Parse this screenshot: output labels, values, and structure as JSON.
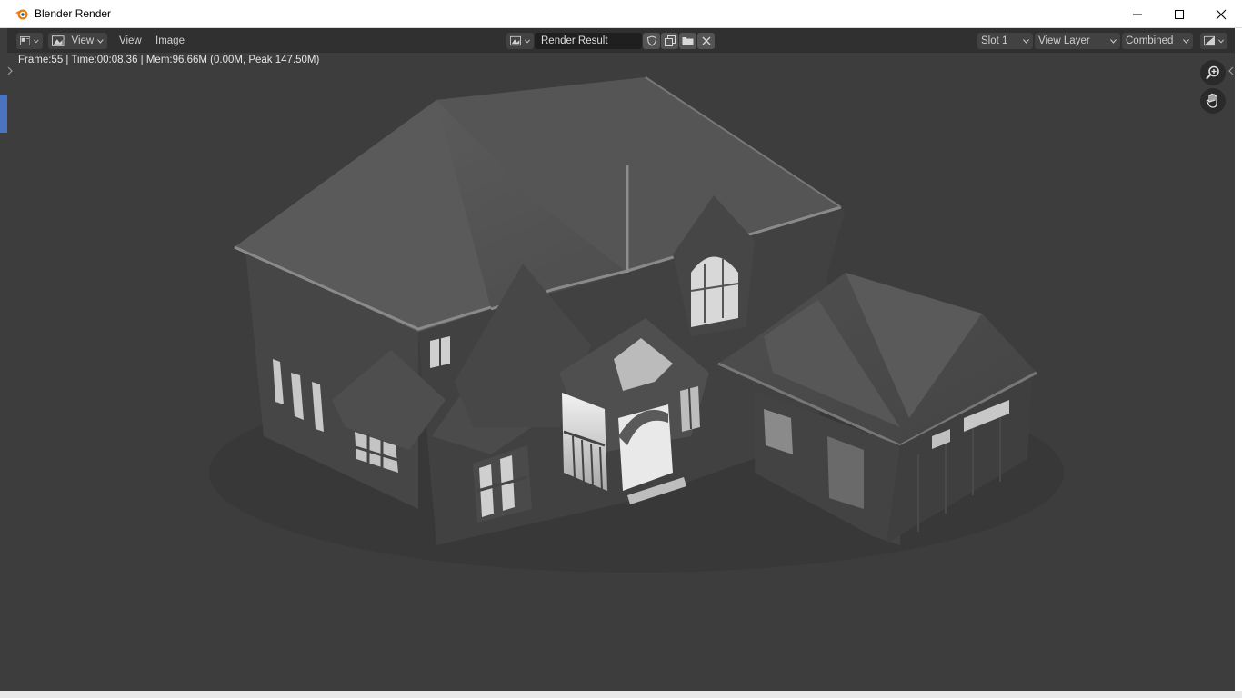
{
  "window": {
    "title": "Blender Render",
    "controls": [
      "minimize",
      "maximize",
      "close"
    ]
  },
  "header": {
    "editor_type_icon": "image-editor-icon",
    "view_menu_dropdown": "View",
    "menus": [
      "View",
      "Image"
    ],
    "image_browse_icon": "image-browse-icon",
    "image_name": "Render Result",
    "tool_icons": [
      "fake-user-shield-icon",
      "duplicate-image-icon",
      "open-image-icon",
      "unlink-x-icon"
    ],
    "slot": "Slot 1",
    "view_layer": "View Layer",
    "pass": "Combined",
    "display_channels_icon": "display-channels-icon"
  },
  "viewport": {
    "stats": "Frame:55 | Time:00:08.36 | Mem:96.66M (0.00M, Peak 147.50M)",
    "nav_tools": [
      "zoom-icon",
      "pan-hand-icon"
    ],
    "scene_subject": "render of house model"
  },
  "colors": {
    "title_bg": "#ffffff",
    "header_bg": "#303030",
    "viewport_bg": "#3d3d3d",
    "render_field_bg": "#1f1f1f",
    "blender_orange": "#e87d0d"
  }
}
